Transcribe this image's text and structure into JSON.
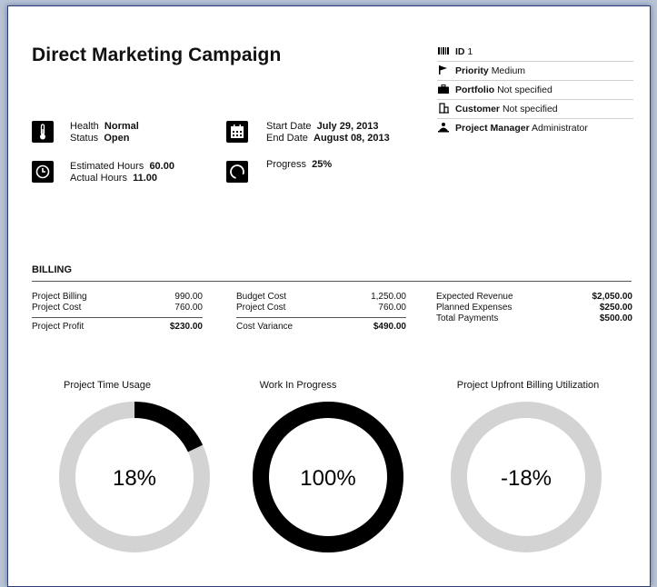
{
  "project": {
    "title": "Direct Marketing Campaign"
  },
  "meta": [
    {
      "icon": "barcode-icon",
      "label": "ID",
      "value": "1",
      "bold_label": true
    },
    {
      "icon": "flag-icon",
      "label": "Priority",
      "value": "Medium",
      "bold_label": true
    },
    {
      "icon": "briefcase-icon",
      "label": "Portfolio",
      "value": "Not specified",
      "bold_label": true
    },
    {
      "icon": "building-icon",
      "label": "Customer",
      "value": "Not specified",
      "bold_label": true
    },
    {
      "icon": "team-icon",
      "label": "Project Manager",
      "value": "Administrator",
      "bold_label": true
    }
  ],
  "info": {
    "health_label": "Health",
    "health_value": "Normal",
    "status_label": "Status",
    "status_value": "Open",
    "start_label": "Start Date",
    "start_value": "July 29, 2013",
    "end_label": "End Date",
    "end_value": "August 08, 2013",
    "est_label": "Estimated Hours",
    "est_value": "60.00",
    "act_label": "Actual Hours",
    "act_value": "11.00",
    "progress_label": "Progress",
    "progress_value": "25%",
    "progress_fraction": 0.25
  },
  "billing": {
    "heading": "BILLING",
    "col1": {
      "rows": [
        {
          "label": "Project Billing",
          "value": "990.00"
        },
        {
          "label": "Project Cost",
          "value": "760.00"
        }
      ],
      "total": {
        "label": "Project Profit",
        "value": "$230.00"
      }
    },
    "col2": {
      "rows": [
        {
          "label": "Budget Cost",
          "value": "1,250.00"
        },
        {
          "label": "Project Cost",
          "value": "760.00"
        }
      ],
      "total": {
        "label": "Cost Variance",
        "value": "$490.00"
      }
    },
    "col3": {
      "rows": [
        {
          "label": "Expected Revenue",
          "value": "$2,050.00"
        },
        {
          "label": "Planned Expenses",
          "value": "$250.00"
        },
        {
          "label": "Total Payments",
          "value": "$500.00"
        }
      ]
    }
  },
  "chart_data": [
    {
      "type": "pie",
      "title": "Project Time Usage",
      "label": "18%",
      "value": 18,
      "max": 100,
      "fill_color": "#000000",
      "track_color": "#d3d3d3"
    },
    {
      "type": "pie",
      "title": "Work In Progress",
      "label": "100%",
      "value": 100,
      "max": 100,
      "fill_color": "#000000",
      "track_color": "#d3d3d3"
    },
    {
      "type": "pie",
      "title": "Project Upfront Billing Utilization",
      "label": "-18%",
      "value": -18,
      "max": 100,
      "fill_color": "#000000",
      "track_color": "#d3d3d3"
    }
  ]
}
